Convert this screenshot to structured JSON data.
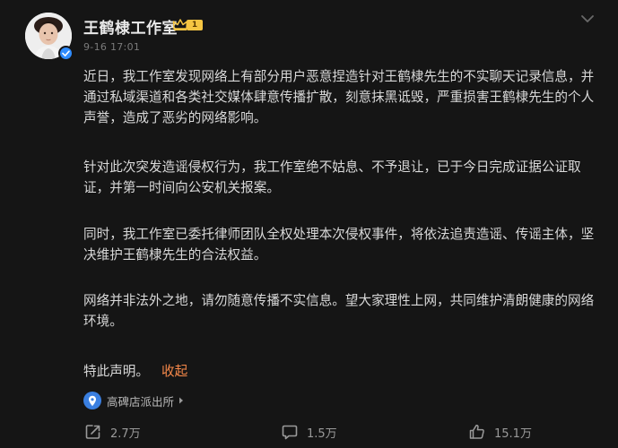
{
  "author": {
    "name": "王鹤棣工作室",
    "fan_level": "1",
    "timestamp": "9-16 17:01"
  },
  "post": {
    "paragraphs": [
      "近日，我工作室发现网络上有部分用户恶意捏造针对王鹤棣先生的不实聊天记录信息，并通过私域渠道和各类社交媒体肆意传播扩散，刻意抹黑诋毁，严重损害王鹤棣先生的个人声誉，造成了恶劣的网络影响。",
      "针对此次突发造谣侵权行为，我工作室绝不姑息、不予退让，已于今日完成证据公证取证，并第一时间向公安机关报案。",
      "同时，我工作室已委托律师团队全权处理本次侵权事件，将依法追责造谣、传谣主体，坚决维护王鹤棣先生的合法权益。",
      "网络并非法外之地，请勿随意传播不实信息。望大家理性上网，共同维护清朗健康的网络环境。",
      "特此声明。"
    ],
    "collapse_label": "收起",
    "location": "高碑店派出所"
  },
  "actions": {
    "share_count": "2.7万",
    "comment_count": "1.5万",
    "like_count": "15.1万"
  },
  "colors": {
    "background": "#151515",
    "text": "#d9d9d9",
    "muted": "#7a7a7a",
    "collapse_link": "#f7894a",
    "verified_blue": "#2f8cff",
    "badge_gold": "#f5c542"
  },
  "icons": [
    "verified-icon",
    "crown-icon",
    "chevron-down-icon",
    "location-pin-icon",
    "chevron-right-icon",
    "share-icon",
    "comment-icon",
    "like-icon"
  ]
}
